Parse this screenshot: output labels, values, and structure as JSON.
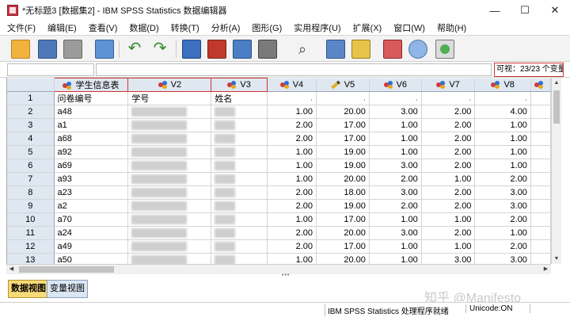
{
  "window": {
    "title": "*无标题3 [数据集2] - IBM SPSS Statistics 数据编辑器",
    "minimize_glyph": "—",
    "maximize_glyph": "☐",
    "close_glyph": "✕"
  },
  "menu": [
    "文件(F)",
    "编辑(E)",
    "查看(V)",
    "数据(D)",
    "转换(T)",
    "分析(A)",
    "图形(G)",
    "实用程序(U)",
    "扩展(X)",
    "窗口(W)",
    "帮助(H)"
  ],
  "toolbar": {
    "icons": [
      "open-folder-icon",
      "save-icon",
      "print-icon",
      "dialog-recall-icon",
      "undo-icon",
      "redo-icon",
      "goto-case-icon",
      "goto-variable-icon",
      "variables-icon",
      "run-descriptive-icon",
      "find-icon",
      "insert-cases-icon",
      "insert-variable-icon",
      "split-file-icon",
      "weight-cases-icon",
      "select-cases-icon",
      "value-labels-icon"
    ]
  },
  "infobar": {
    "visible_label": "可视：23/23 个变量"
  },
  "grid": {
    "columns": [
      "学生信息表",
      "V2",
      "V3",
      "V4",
      "V5",
      "V6",
      "V7",
      "V8",
      ""
    ],
    "rows": [
      {
        "n": "1",
        "c1": "问卷编号",
        "c2": "学号",
        "c3": "姓名",
        "v4": ".",
        "v5": ".",
        "v6": ".",
        "v7": ".",
        "v8": "."
      },
      {
        "n": "2",
        "c1": "a48",
        "c2": "",
        "c3": "",
        "v4": "1.00",
        "v5": "20.00",
        "v6": "3.00",
        "v7": "2.00",
        "v8": "4.00"
      },
      {
        "n": "3",
        "c1": "a1",
        "c2": "",
        "c3": "",
        "v4": "2.00",
        "v5": "17.00",
        "v6": "1.00",
        "v7": "2.00",
        "v8": "1.00"
      },
      {
        "n": "4",
        "c1": "a68",
        "c2": "",
        "c3": "",
        "v4": "2.00",
        "v5": "17.00",
        "v6": "1.00",
        "v7": "2.00",
        "v8": "1.00"
      },
      {
        "n": "5",
        "c1": "a92",
        "c2": "",
        "c3": "",
        "v4": "1.00",
        "v5": "19.00",
        "v6": "1.00",
        "v7": "2.00",
        "v8": "1.00"
      },
      {
        "n": "6",
        "c1": "a69",
        "c2": "",
        "c3": "",
        "v4": "1.00",
        "v5": "19.00",
        "v6": "3.00",
        "v7": "2.00",
        "v8": "1.00"
      },
      {
        "n": "7",
        "c1": "a93",
        "c2": "",
        "c3": "",
        "v4": "1.00",
        "v5": "20.00",
        "v6": "2.00",
        "v7": "1.00",
        "v8": "2.00"
      },
      {
        "n": "8",
        "c1": "a23",
        "c2": "",
        "c3": "",
        "v4": "2.00",
        "v5": "18.00",
        "v6": "3.00",
        "v7": "2.00",
        "v8": "3.00"
      },
      {
        "n": "9",
        "c1": "a2",
        "c2": "",
        "c3": "",
        "v4": "2.00",
        "v5": "19.00",
        "v6": "2.00",
        "v7": "2.00",
        "v8": "3.00"
      },
      {
        "n": "10",
        "c1": "a70",
        "c2": "",
        "c3": "",
        "v4": "1.00",
        "v5": "17.00",
        "v6": "1.00",
        "v7": "1.00",
        "v8": "2.00"
      },
      {
        "n": "11",
        "c1": "a24",
        "c2": "",
        "c3": "",
        "v4": "2.00",
        "v5": "20.00",
        "v6": "3.00",
        "v7": "2.00",
        "v8": "1.00"
      },
      {
        "n": "12",
        "c1": "a49",
        "c2": "",
        "c3": "",
        "v4": "2.00",
        "v5": "17.00",
        "v6": "1.00",
        "v7": "1.00",
        "v8": "2.00"
      },
      {
        "n": "13",
        "c1": "a50",
        "c2": "",
        "c3": "",
        "v4": "1.00",
        "v5": "20.00",
        "v6": "1.00",
        "v7": "3.00",
        "v8": "3.00"
      }
    ]
  },
  "tabs": {
    "data_view": "数据视图",
    "variable_view": "变量视图"
  },
  "status": {
    "processor": "IBM SPSS Statistics 处理程序就绪",
    "unicode": "Unicode:ON"
  },
  "watermark": "知乎 @Manifesto",
  "colors": {
    "header_bg": "#dfe7f1",
    "active_tab": "#f7d978",
    "highlight_border": "#d0352e"
  }
}
